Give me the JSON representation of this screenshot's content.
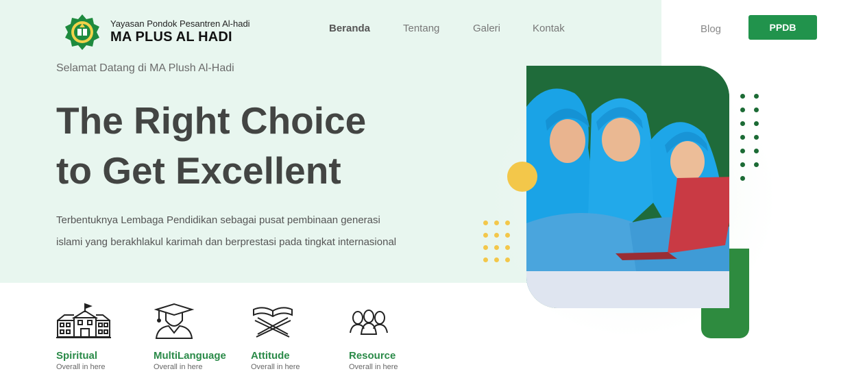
{
  "brand": {
    "subtitle": "Yayasan Pondok Pesantren Al-hadi",
    "name": "MA PLUS AL HADI"
  },
  "nav": {
    "items": [
      {
        "label": "Beranda",
        "active": true
      },
      {
        "label": "Tentang",
        "active": false
      },
      {
        "label": "Galeri",
        "active": false
      },
      {
        "label": "Kontak",
        "active": false
      }
    ],
    "blog_label": "Blog",
    "ppdb_label": "PPDB"
  },
  "hero": {
    "welcome": "Selamat Datang di MA Plush Al-Hadi",
    "headline_line1": "The Right Choice",
    "headline_line2": "to Get Excellent",
    "description_line1": "Terbentuknya Lembaga Pendidikan sebagai pusat pembinaan generasi",
    "description_line2": "islami yang berakhlakul karimah dan berprestasi pada tingkat internasional"
  },
  "features": [
    {
      "title": "Spiritual",
      "subtitle": "Overall in here",
      "icon": "school-building-icon"
    },
    {
      "title": "MultiLanguage",
      "subtitle": "Overall in here",
      "icon": "graduate-icon"
    },
    {
      "title": "Attitude",
      "subtitle": "Overall in here",
      "icon": "quran-stand-icon"
    },
    {
      "title": "Resource",
      "subtitle": "Overall in here",
      "icon": "people-group-icon"
    }
  ],
  "colors": {
    "primary_green": "#21934c",
    "hero_background": "#e8f6ef",
    "accent_yellow": "#f3c74a",
    "dark_green": "#1c6b35"
  }
}
